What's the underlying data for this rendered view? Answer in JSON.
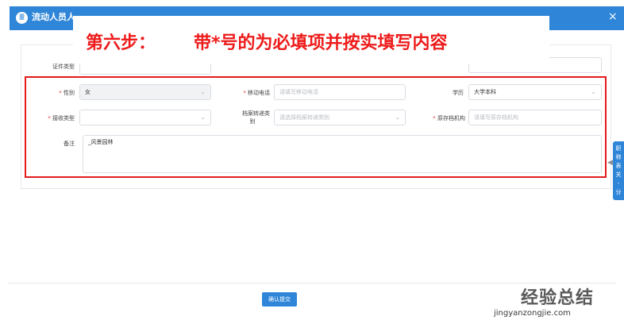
{
  "dialog": {
    "title": "流动人员人",
    "close": "×",
    "icon": "form-icon"
  },
  "banner": {
    "step": "第六步：",
    "text": "带*号的为必填项并按实填写内容"
  },
  "form": {
    "id_type_label": "证件类型",
    "gender": {
      "required": "*",
      "label": "性别",
      "value": "女"
    },
    "mobile": {
      "required": "*",
      "label": "移动电话",
      "placeholder": "请填写移动电话"
    },
    "education": {
      "label": "学历",
      "value": "大学本科"
    },
    "receive_type": {
      "required": "*",
      "label": "接收类型",
      "value": ""
    },
    "archive_transfer": {
      "label": "档案转递类",
      "label_cont": "别",
      "placeholder": "请选择档案转递类别"
    },
    "archive_org": {
      "required": "*",
      "label": "原存档机构",
      "placeholder": "请填写原存档机构"
    },
    "remarks": {
      "label": "备注",
      "value": "_风景园林"
    }
  },
  "side_tab": {
    "chars": [
      "职",
      "称",
      "表",
      "关",
      "-",
      "分"
    ]
  },
  "footer": {
    "submit_label": "确认提交"
  },
  "watermark": {
    "main": "经验总结",
    "url": "jingyanzongjie.com"
  }
}
